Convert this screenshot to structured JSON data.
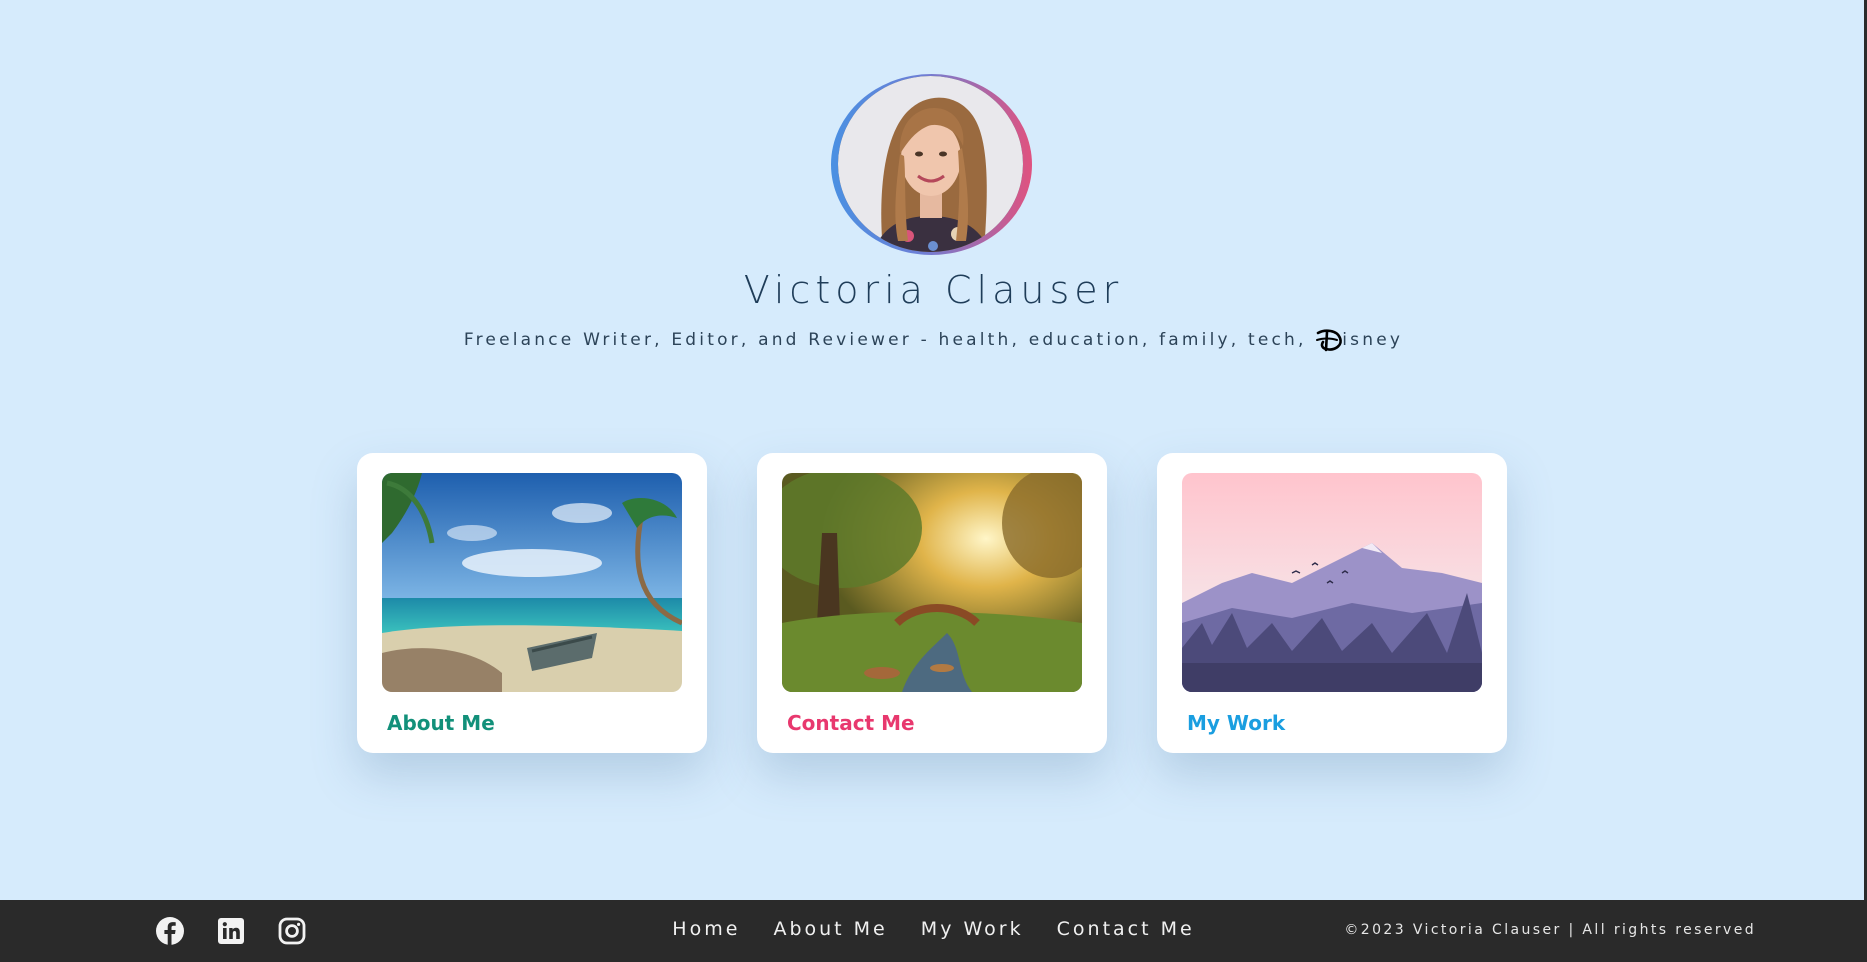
{
  "profile": {
    "name": "Victoria Clauser",
    "tagline": "Freelance Writer, Editor, and Reviewer - health, education, family, tech,",
    "tagline_brand_suffix": "isney",
    "avatar_icon": "portrait-photo"
  },
  "cards": [
    {
      "title": "About Me",
      "color": "#12907a",
      "image": "tropical-beach-painting"
    },
    {
      "title": "Contact Me",
      "color": "#e8386e",
      "image": "forest-bridge-painting"
    },
    {
      "title": "My Work",
      "color": "#1a9ee0",
      "image": "mountain-sunset-illustration"
    }
  ],
  "footer": {
    "social": [
      "facebook-icon",
      "linkedin-icon",
      "instagram-icon"
    ],
    "nav": [
      "Home",
      "About Me",
      "My Work",
      "Contact Me"
    ],
    "copyright": "©2023 Victoria Clauser | All rights reserved"
  },
  "colors": {
    "background": "#d6ebfc",
    "footer": "#2a2a2a",
    "name_text": "#1f3d59"
  }
}
